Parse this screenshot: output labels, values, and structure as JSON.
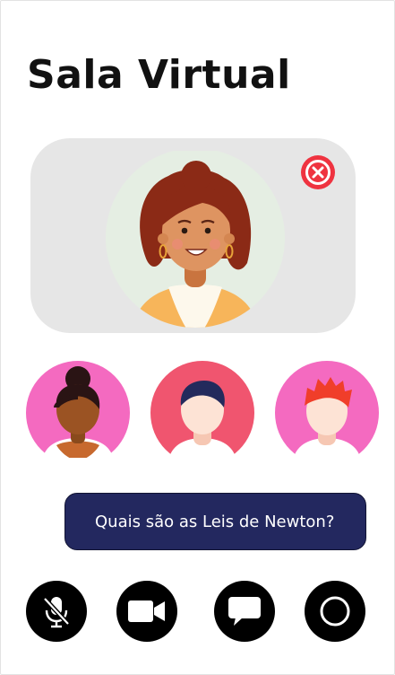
{
  "app": {
    "title": "Sala Virtual"
  },
  "main_participant": {
    "avatar_icon": "woman-curly-hair-avatar-icon",
    "close_icon": "close-circle-icon",
    "close_color": "#ef3340"
  },
  "participants": [
    {
      "avatar_icon": "woman-hair-bun-avatar-icon",
      "bg_color": "#f46ac0"
    },
    {
      "avatar_icon": "man-dark-hair-avatar-icon",
      "bg_color": "#f0556f"
    },
    {
      "avatar_icon": "man-red-hair-avatar-icon",
      "bg_color": "#f46ac0"
    }
  ],
  "chat": {
    "message": "Quais são as Leis de Newton?",
    "bubble_color": "#23285f"
  },
  "controls": [
    {
      "icon": "microphone-muted-icon"
    },
    {
      "icon": "video-camera-icon"
    },
    {
      "icon": "chat-bubble-icon"
    },
    {
      "icon": "record-circle-icon"
    }
  ]
}
